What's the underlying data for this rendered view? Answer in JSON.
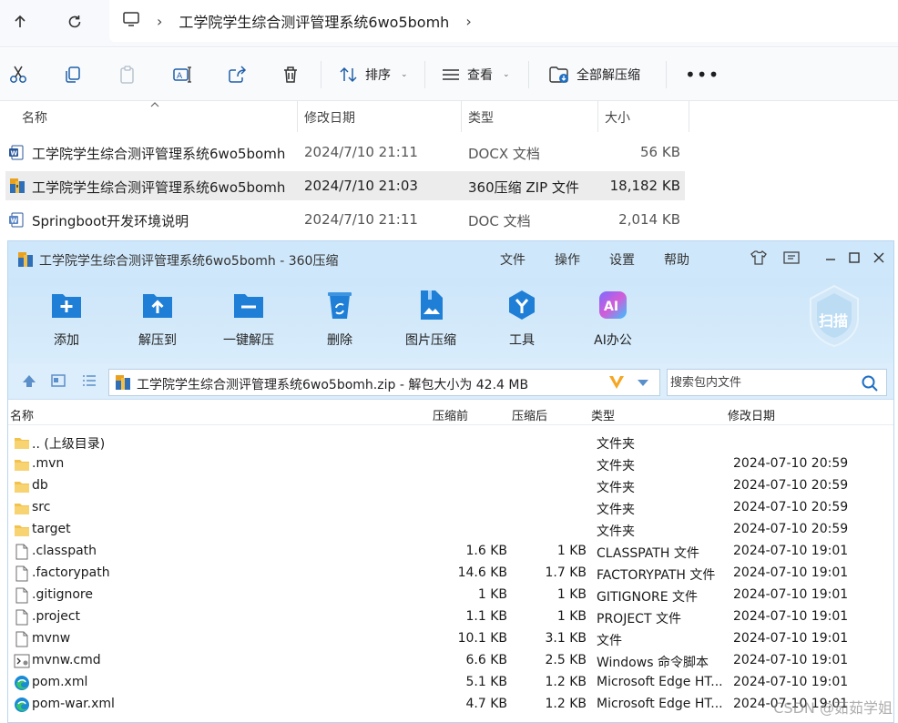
{
  "explorer": {
    "breadcrumb": {
      "current": "工学院学生综合测评管理系统6wo5bomh"
    },
    "commands": {
      "sort": "排序",
      "view": "查看",
      "extract_all": "全部解压缩"
    },
    "columns": {
      "name": "名称",
      "modified": "修改日期",
      "type": "类型",
      "size": "大小"
    },
    "files": [
      {
        "name": "工学院学生综合测评管理系统6wo5bomh",
        "modified": "2024/7/10 21:11",
        "type": "DOCX 文档",
        "size": "56 KB",
        "icon": "word-doc-icon"
      },
      {
        "name": "工学院学生综合测评管理系统6wo5bomh",
        "modified": "2024/7/10 21:03",
        "type": "360压缩 ZIP 文件",
        "size": "18,182 KB",
        "icon": "zip-archive-icon"
      },
      {
        "name": "Springboot开发环境说明",
        "modified": "2024/7/10 21:11",
        "type": "DOC 文档",
        "size": "2,014 KB",
        "icon": "word-doc-icon"
      }
    ]
  },
  "archive": {
    "title": "工学院学生综合测评管理系统6wo5bomh - 360压缩",
    "menu": [
      "文件",
      "操作",
      "设置",
      "帮助"
    ],
    "toolbar": [
      "添加",
      "解压到",
      "一键解压",
      "删除",
      "图片压缩",
      "工具",
      "AI办公"
    ],
    "scan_label": "扫描",
    "path_text": "工学院学生综合测评管理系统6wo5bomh.zip - 解包大小为 42.4 MB",
    "search_placeholder": "搜索包内文件",
    "columns": {
      "name": "名称",
      "before": "压缩前",
      "after": "压缩后",
      "type": "类型",
      "modified": "修改日期"
    },
    "rows": [
      {
        "name": ".. (上级目录)",
        "before": "",
        "after": "",
        "type": "文件夹",
        "modified": "",
        "icon": "folder"
      },
      {
        "name": ".mvn",
        "before": "",
        "after": "",
        "type": "文件夹",
        "modified": "2024-07-10 20:59",
        "icon": "folder"
      },
      {
        "name": "db",
        "before": "",
        "after": "",
        "type": "文件夹",
        "modified": "2024-07-10 20:59",
        "icon": "folder"
      },
      {
        "name": "src",
        "before": "",
        "after": "",
        "type": "文件夹",
        "modified": "2024-07-10 20:59",
        "icon": "folder"
      },
      {
        "name": "target",
        "before": "",
        "after": "",
        "type": "文件夹",
        "modified": "2024-07-10 20:59",
        "icon": "folder"
      },
      {
        "name": ".classpath",
        "before": "1.6 KB",
        "after": "1 KB",
        "type": "CLASSPATH 文件",
        "modified": "2024-07-10 19:01",
        "icon": "file"
      },
      {
        "name": ".factorypath",
        "before": "14.6 KB",
        "after": "1.7 KB",
        "type": "FACTORYPATH 文件",
        "modified": "2024-07-10 19:01",
        "icon": "file"
      },
      {
        "name": ".gitignore",
        "before": "1 KB",
        "after": "1 KB",
        "type": "GITIGNORE 文件",
        "modified": "2024-07-10 19:01",
        "icon": "file"
      },
      {
        "name": ".project",
        "before": "1.1 KB",
        "after": "1 KB",
        "type": "PROJECT 文件",
        "modified": "2024-07-10 19:01",
        "icon": "file"
      },
      {
        "name": "mvnw",
        "before": "10.1 KB",
        "after": "3.1 KB",
        "type": "文件",
        "modified": "2024-07-10 19:01",
        "icon": "file"
      },
      {
        "name": "mvnw.cmd",
        "before": "6.6 KB",
        "after": "2.5 KB",
        "type": "Windows 命令脚本",
        "modified": "2024-07-10 19:01",
        "icon": "cmd"
      },
      {
        "name": "pom.xml",
        "before": "5.1 KB",
        "after": "1.2 KB",
        "type": "Microsoft Edge HT...",
        "modified": "2024-07-10 19:01",
        "icon": "edge"
      },
      {
        "name": "pom-war.xml",
        "before": "4.7 KB",
        "after": "1.2 KB",
        "type": "Microsoft Edge HT...",
        "modified": "2024-07-10 19:01",
        "icon": "edge"
      }
    ]
  },
  "watermark": "CSDN @茹茹学姐"
}
